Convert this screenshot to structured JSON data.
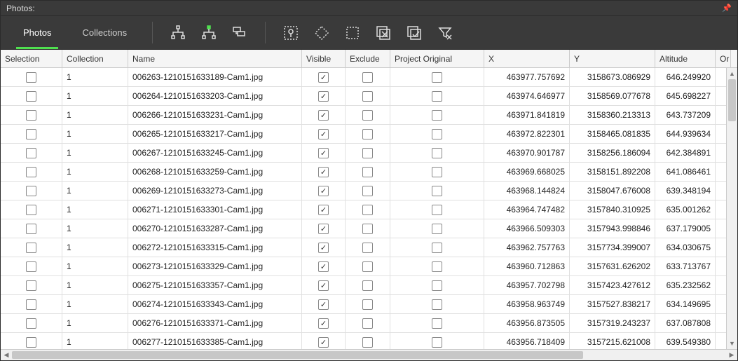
{
  "panel_title": "Photos:",
  "tabs": {
    "photos": "Photos",
    "collections": "Collections"
  },
  "columns": {
    "selection": "Selection",
    "collection": "Collection",
    "name": "Name",
    "visible": "Visible",
    "exclude": "Exclude",
    "project_original": "Project Original",
    "x": "X",
    "y": "Y",
    "altitude": "Altitude",
    "or": "Or"
  },
  "rows": [
    {
      "collection": "1",
      "name": "006263-1210151633189-Cam1.jpg",
      "visible": true,
      "x": "463977.757692",
      "y": "3158673.086929",
      "altitude": "646.249920"
    },
    {
      "collection": "1",
      "name": "006264-1210151633203-Cam1.jpg",
      "visible": true,
      "x": "463974.646977",
      "y": "3158569.077678",
      "altitude": "645.698227"
    },
    {
      "collection": "1",
      "name": "006266-1210151633231-Cam1.jpg",
      "visible": true,
      "x": "463971.841819",
      "y": "3158360.213313",
      "altitude": "643.737209"
    },
    {
      "collection": "1",
      "name": "006265-1210151633217-Cam1.jpg",
      "visible": true,
      "x": "463972.822301",
      "y": "3158465.081835",
      "altitude": "644.939634"
    },
    {
      "collection": "1",
      "name": "006267-1210151633245-Cam1.jpg",
      "visible": true,
      "x": "463970.901787",
      "y": "3158256.186094",
      "altitude": "642.384891"
    },
    {
      "collection": "1",
      "name": "006268-1210151633259-Cam1.jpg",
      "visible": true,
      "x": "463969.668025",
      "y": "3158151.892208",
      "altitude": "641.086461"
    },
    {
      "collection": "1",
      "name": "006269-1210151633273-Cam1.jpg",
      "visible": true,
      "x": "463968.144824",
      "y": "3158047.676008",
      "altitude": "639.348194"
    },
    {
      "collection": "1",
      "name": "006271-1210151633301-Cam1.jpg",
      "visible": true,
      "x": "463964.747482",
      "y": "3157840.310925",
      "altitude": "635.001262"
    },
    {
      "collection": "1",
      "name": "006270-1210151633287-Cam1.jpg",
      "visible": true,
      "x": "463966.509303",
      "y": "3157943.998846",
      "altitude": "637.179005"
    },
    {
      "collection": "1",
      "name": "006272-1210151633315-Cam1.jpg",
      "visible": true,
      "x": "463962.757763",
      "y": "3157734.399007",
      "altitude": "634.030675"
    },
    {
      "collection": "1",
      "name": "006273-1210151633329-Cam1.jpg",
      "visible": true,
      "x": "463960.712863",
      "y": "3157631.626202",
      "altitude": "633.713767"
    },
    {
      "collection": "1",
      "name": "006275-1210151633357-Cam1.jpg",
      "visible": true,
      "x": "463957.702798",
      "y": "3157423.427612",
      "altitude": "635.232562"
    },
    {
      "collection": "1",
      "name": "006274-1210151633343-Cam1.jpg",
      "visible": true,
      "x": "463958.963749",
      "y": "3157527.838217",
      "altitude": "634.149695"
    },
    {
      "collection": "1",
      "name": "006276-1210151633371-Cam1.jpg",
      "visible": true,
      "x": "463956.873505",
      "y": "3157319.243237",
      "altitude": "637.087808"
    },
    {
      "collection": "1",
      "name": "006277-1210151633385-Cam1.jpg",
      "visible": true,
      "x": "463956.718409",
      "y": "3157215.621008",
      "altitude": "639.549380"
    }
  ]
}
